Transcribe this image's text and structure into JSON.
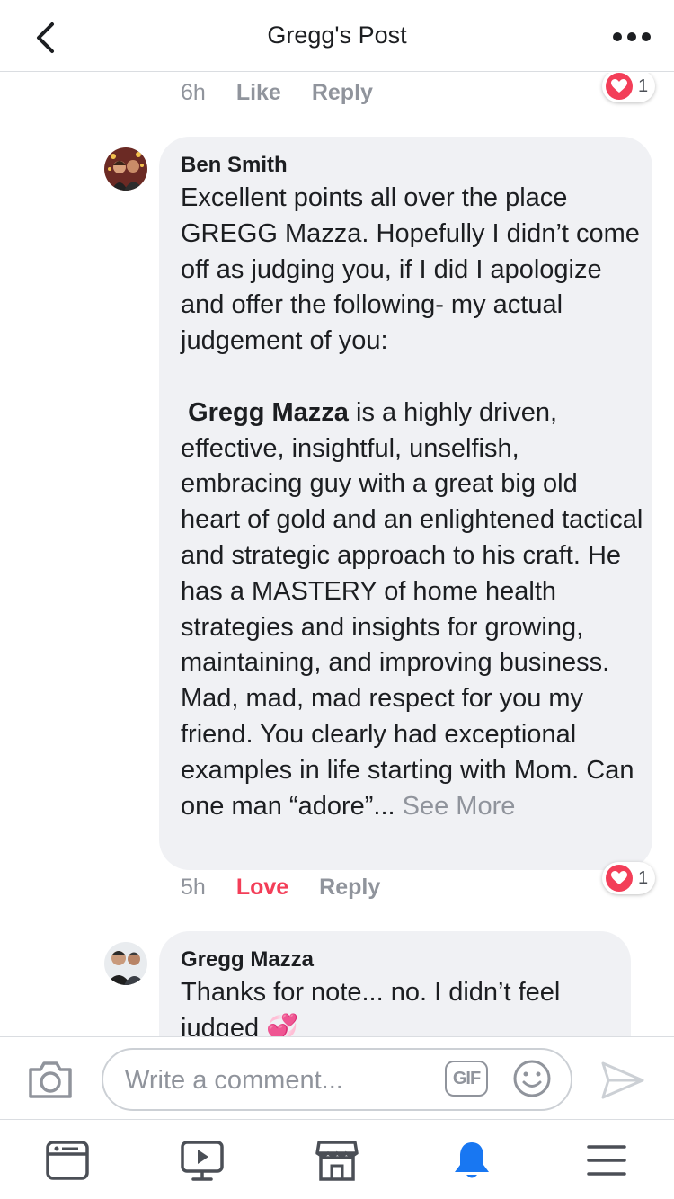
{
  "header": {
    "title": "Gregg's Post",
    "back_icon": "chevron-left-icon",
    "more_icon": "ellipsis-icon"
  },
  "top_comment_meta": {
    "time": "6h",
    "like": "Like",
    "reply": "Reply",
    "reaction_count": "1"
  },
  "comments": [
    {
      "author": "Ben Smith",
      "text_part1": "Excellent points all over the place GREGG Mazza. Hopefully I didn’t come off as judging you, if I did I apologize and offer the following- my actual judgement of you:\n\n ",
      "mention": "Gregg Mazza",
      "text_part2": " is a highly driven, effective, insightful, unselfish, embracing guy with a great big old heart of gold and an enlightened tactical and strategic approach to his craft. He has a MASTERY of home health strategies and insights for growing, maintaining, and improving business. Mad, mad, mad respect for you my friend. You clearly had exceptional examples in life starting with Mom. Can one man “adore”... ",
      "see_more": "See More",
      "time": "5h",
      "love": "Love",
      "reply": "Reply",
      "reaction_count": "1"
    },
    {
      "author": "Gregg Mazza",
      "text": "Thanks for note... no. I didn’t feel judged 💞"
    }
  ],
  "composer": {
    "placeholder": "Write a comment...",
    "gif_label": "GIF"
  },
  "tabbar": {
    "items": [
      "news-feed-icon",
      "watch-icon",
      "marketplace-icon",
      "notifications-icon",
      "menu-icon"
    ],
    "active": "notifications-icon"
  },
  "colors": {
    "love": "#f33e58",
    "active_tab": "#1877f2",
    "bubble": "#f0f1f4",
    "muted": "#90949c"
  }
}
